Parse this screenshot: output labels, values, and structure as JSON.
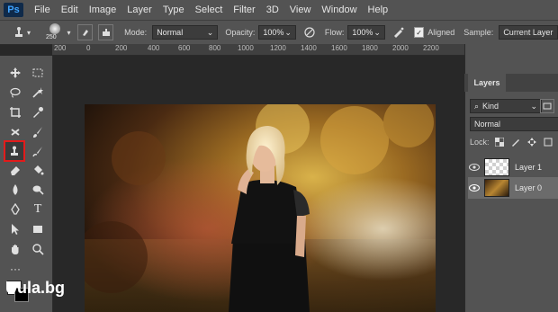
{
  "app": {
    "logo": "Ps"
  },
  "menu": [
    "File",
    "Edit",
    "Image",
    "Layer",
    "Type",
    "Select",
    "Filter",
    "3D",
    "View",
    "Window",
    "Help"
  ],
  "options": {
    "brush_size": "250",
    "mode_label": "Mode:",
    "mode_value": "Normal",
    "opacity_label": "Opacity:",
    "opacity_value": "100%",
    "flow_label": "Flow:",
    "flow_value": "100%",
    "aligned_label": "Aligned",
    "aligned_checked": true,
    "sample_label": "Sample:",
    "sample_value": "Current Layer"
  },
  "ruler": [
    "200",
    "0",
    "200",
    "400",
    "600",
    "800",
    "1000",
    "1200",
    "1400",
    "1600",
    "1800",
    "2000",
    "2200"
  ],
  "layers": {
    "tab": "Layers",
    "filter_label": "Kind",
    "blend_mode": "Normal",
    "lock_label": "Lock:",
    "items": [
      {
        "name": "Layer 1",
        "visible": true
      },
      {
        "name": "Layer 0",
        "visible": true
      }
    ]
  },
  "watermark": "Uula.bg"
}
